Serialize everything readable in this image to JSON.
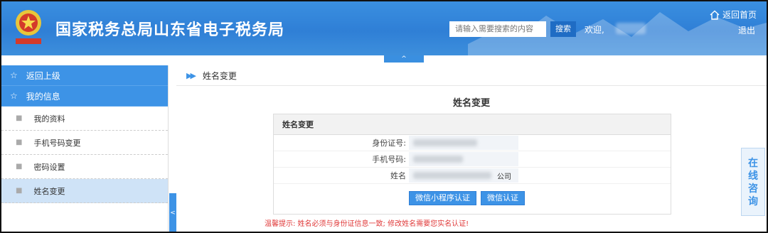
{
  "header": {
    "title": "国家税务总局山东省电子税务局",
    "search_placeholder": "请输入需要搜索的内容",
    "search_button": "搜索",
    "welcome": "欢迎,",
    "home_link": "返回首页",
    "logout": "退出",
    "collapse_arrow": "^",
    "bg_color": "#3a8fe0"
  },
  "sidebar": {
    "back": "返回上级",
    "section": "我的信息",
    "items": [
      {
        "label": "我的资料"
      },
      {
        "label": "手机号码变更"
      },
      {
        "label": "密码设置"
      },
      {
        "label": "姓名变更"
      }
    ],
    "toggle": "<"
  },
  "main": {
    "breadcrumb": "姓名变更",
    "page_title": "姓名变更",
    "form": {
      "header": "姓名变更",
      "fields": [
        {
          "label": "身份证号:"
        },
        {
          "label": "手机号码:"
        },
        {
          "label": "姓名",
          "suffix": "公司"
        }
      ],
      "btn_mini": "微信小程序认证",
      "btn_wechat": "微信认证"
    },
    "warning": "温馨提示: 姓名必须与身份证信息一致; 修改姓名需要您实名认证!"
  },
  "consult": {
    "chars": [
      "在",
      "线",
      "咨",
      "询"
    ]
  }
}
